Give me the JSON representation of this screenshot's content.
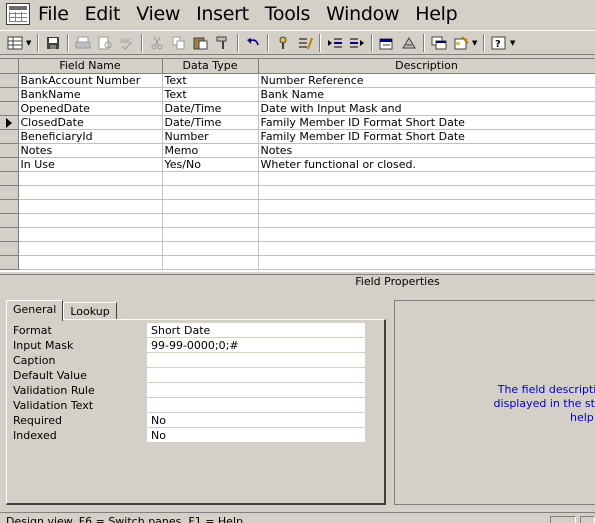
{
  "menubar": {
    "items": [
      "File",
      "Edit",
      "View",
      "Insert",
      "Tools",
      "Window",
      "Help"
    ]
  },
  "toolbar": {
    "icons": [
      "view-icon",
      "save-icon",
      "print-icon",
      "print-preview-icon",
      "spelling-icon",
      "cut-icon",
      "copy-icon",
      "paste-icon",
      "format-painter-icon",
      "undo-icon",
      "primary-key-icon",
      "indexes-icon",
      "insert-rows-icon",
      "delete-rows-icon",
      "properties-icon",
      "build-icon",
      "database-window-icon",
      "new-object-icon",
      "help-icon"
    ]
  },
  "table": {
    "headers": [
      "Field Name",
      "Data Type",
      "Description"
    ],
    "rows": [
      {
        "name": "BankAccount Number",
        "type": "Text",
        "desc": "Number Reference"
      },
      {
        "name": "BankName",
        "type": "Text",
        "desc": "Bank Name"
      },
      {
        "name": "OpenedDate",
        "type": "Date/Time",
        "desc": "Date with Input Mask and"
      },
      {
        "name": "ClosedDate",
        "type": "Date/Time",
        "desc": "Family Member ID Format Short Date"
      },
      {
        "name": "BeneficiaryId",
        "type": "Number",
        "desc": "Family Member ID Format Short Date"
      },
      {
        "name": "Notes",
        "type": "Memo",
        "desc": "Notes"
      },
      {
        "name": "In Use",
        "type": "Yes/No",
        "desc": "Wheter functional or closed."
      }
    ],
    "current_row": 3
  },
  "field_properties": {
    "title": "Field Properties",
    "tabs": [
      "General",
      "Lookup"
    ],
    "properties": [
      {
        "label": "Format",
        "value": "Short Date"
      },
      {
        "label": "Input Mask",
        "value": "99-99-0000;0;#"
      },
      {
        "label": "Caption",
        "value": ""
      },
      {
        "label": "Default Value",
        "value": ""
      },
      {
        "label": "Validation Rule",
        "value": ""
      },
      {
        "label": "Validation Text",
        "value": ""
      },
      {
        "label": "Required",
        "value": "No"
      },
      {
        "label": "Indexed",
        "value": "No"
      }
    ],
    "help_lines": [
      "The field description is optional.  It help",
      "displayed in the status bar when you sel",
      "help on desc"
    ]
  },
  "statusbar": {
    "text": "Design view.  F6 = Switch panes.  F1 = Help."
  }
}
